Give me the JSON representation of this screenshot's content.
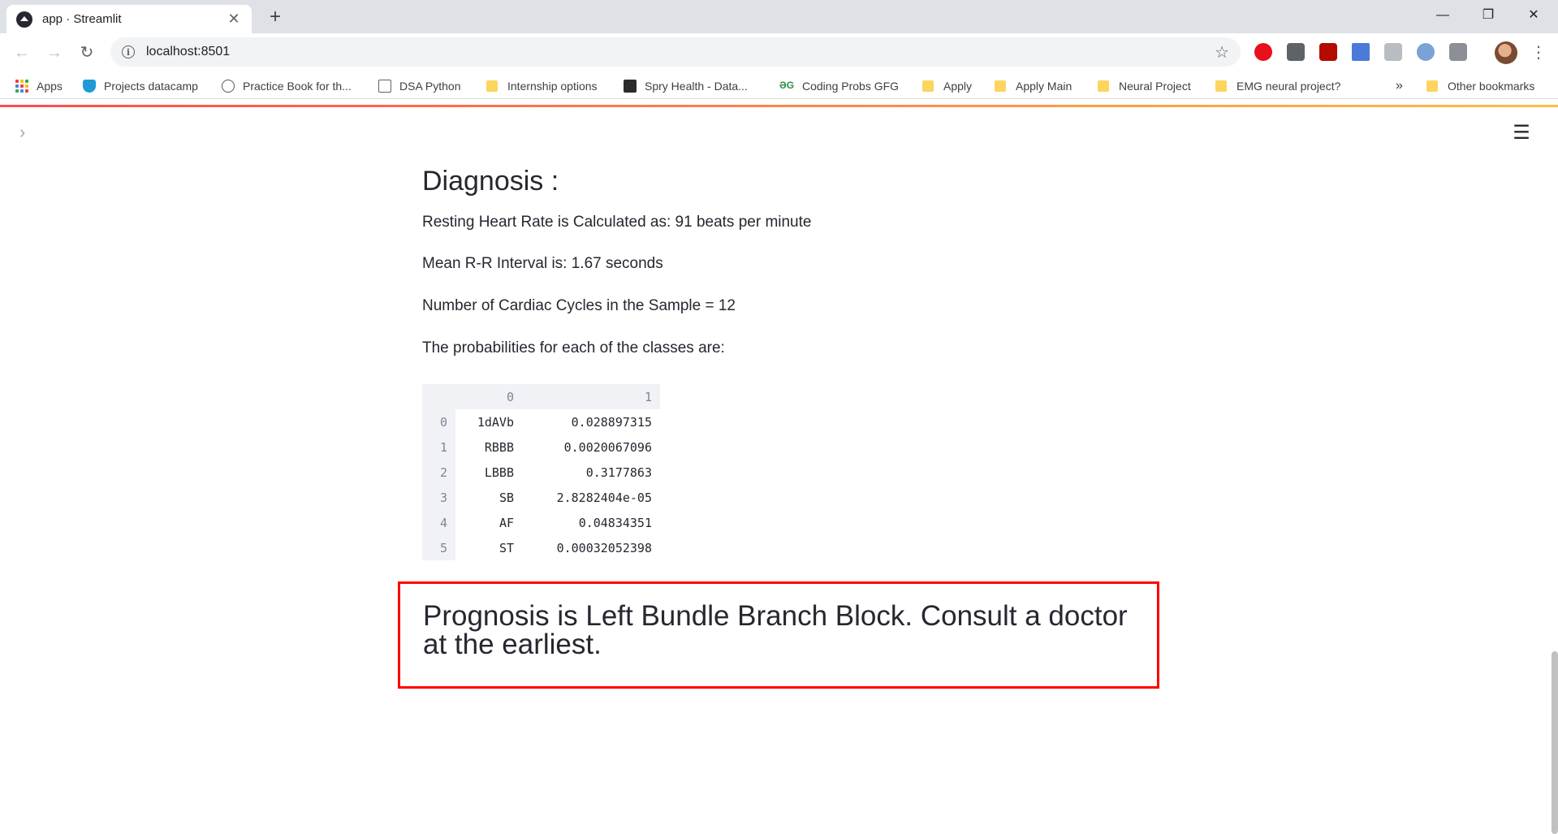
{
  "browser": {
    "tab_title": "app · Streamlit",
    "url": "localhost:8501",
    "bookmarks": [
      {
        "label": "Apps",
        "icon": "apps-grid-icon"
      },
      {
        "label": "Projects datacamp",
        "icon": "shield-icon"
      },
      {
        "label": "Practice Book for th...",
        "icon": "ets-icon"
      },
      {
        "label": "DSA Python",
        "icon": "notebook-icon"
      },
      {
        "label": "Internship options",
        "icon": "folder-icon"
      },
      {
        "label": "Spry Health - Data...",
        "icon": "spry-icon"
      },
      {
        "label": "Coding Probs GFG",
        "icon": "gfg-icon"
      },
      {
        "label": "Apply",
        "icon": "folder-icon"
      },
      {
        "label": "Apply Main",
        "icon": "folder-icon"
      },
      {
        "label": "Neural Project",
        "icon": "folder-icon"
      },
      {
        "label": "EMG neural project?",
        "icon": "folder-icon"
      }
    ],
    "bookmarks_overflow": "»",
    "other_bookmarks": "Other bookmarks"
  },
  "app": {
    "heading": "Diagnosis :",
    "heart_rate_line": "Resting Heart Rate is Calculated as: 91 beats per minute",
    "rr_interval_line": "Mean R-R Interval is: 1.67 seconds",
    "cycles_line": "Number of Cardiac Cycles in the Sample = 12",
    "probabilities_intro": "The probabilities for each of the classes are:",
    "table": {
      "columns": [
        "0",
        "1"
      ],
      "rows": [
        {
          "index": "0",
          "cls": "1dAVb",
          "prob": "0.028897315"
        },
        {
          "index": "1",
          "cls": "RBBB",
          "prob": "0.0020067096"
        },
        {
          "index": "2",
          "cls": "LBBB",
          "prob": "0.3177863"
        },
        {
          "index": "3",
          "cls": "SB",
          "prob": "2.8282404e-05"
        },
        {
          "index": "4",
          "cls": "AF",
          "prob": "0.04834351"
        },
        {
          "index": "5",
          "cls": "ST",
          "prob": "0.00032052398"
        }
      ]
    },
    "prognosis": "Prognosis is Left Bundle Branch Block. Consult a doctor at the earliest."
  },
  "colors": {
    "highlight_border": "#ff0000",
    "decoration_start": "#ff4b4b",
    "decoration_end": "#ffbd45",
    "text": "#262730"
  }
}
